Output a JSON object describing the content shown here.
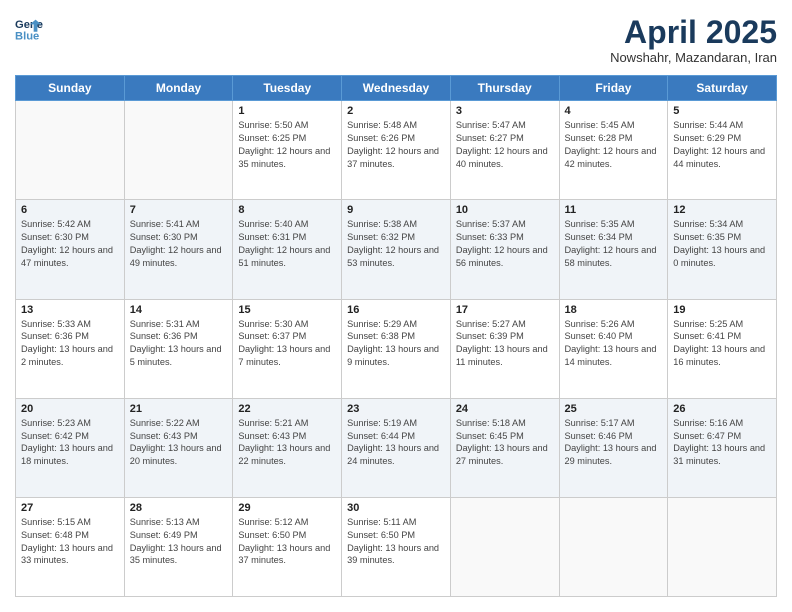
{
  "header": {
    "logo_line1": "General",
    "logo_line2": "Blue",
    "month": "April 2025",
    "location": "Nowshahr, Mazandaran, Iran"
  },
  "days_of_week": [
    "Sunday",
    "Monday",
    "Tuesday",
    "Wednesday",
    "Thursday",
    "Friday",
    "Saturday"
  ],
  "weeks": [
    [
      {
        "day": "",
        "info": ""
      },
      {
        "day": "",
        "info": ""
      },
      {
        "day": "1",
        "info": "Sunrise: 5:50 AM\nSunset: 6:25 PM\nDaylight: 12 hours and 35 minutes."
      },
      {
        "day": "2",
        "info": "Sunrise: 5:48 AM\nSunset: 6:26 PM\nDaylight: 12 hours and 37 minutes."
      },
      {
        "day": "3",
        "info": "Sunrise: 5:47 AM\nSunset: 6:27 PM\nDaylight: 12 hours and 40 minutes."
      },
      {
        "day": "4",
        "info": "Sunrise: 5:45 AM\nSunset: 6:28 PM\nDaylight: 12 hours and 42 minutes."
      },
      {
        "day": "5",
        "info": "Sunrise: 5:44 AM\nSunset: 6:29 PM\nDaylight: 12 hours and 44 minutes."
      }
    ],
    [
      {
        "day": "6",
        "info": "Sunrise: 5:42 AM\nSunset: 6:30 PM\nDaylight: 12 hours and 47 minutes."
      },
      {
        "day": "7",
        "info": "Sunrise: 5:41 AM\nSunset: 6:30 PM\nDaylight: 12 hours and 49 minutes."
      },
      {
        "day": "8",
        "info": "Sunrise: 5:40 AM\nSunset: 6:31 PM\nDaylight: 12 hours and 51 minutes."
      },
      {
        "day": "9",
        "info": "Sunrise: 5:38 AM\nSunset: 6:32 PM\nDaylight: 12 hours and 53 minutes."
      },
      {
        "day": "10",
        "info": "Sunrise: 5:37 AM\nSunset: 6:33 PM\nDaylight: 12 hours and 56 minutes."
      },
      {
        "day": "11",
        "info": "Sunrise: 5:35 AM\nSunset: 6:34 PM\nDaylight: 12 hours and 58 minutes."
      },
      {
        "day": "12",
        "info": "Sunrise: 5:34 AM\nSunset: 6:35 PM\nDaylight: 13 hours and 0 minutes."
      }
    ],
    [
      {
        "day": "13",
        "info": "Sunrise: 5:33 AM\nSunset: 6:36 PM\nDaylight: 13 hours and 2 minutes."
      },
      {
        "day": "14",
        "info": "Sunrise: 5:31 AM\nSunset: 6:36 PM\nDaylight: 13 hours and 5 minutes."
      },
      {
        "day": "15",
        "info": "Sunrise: 5:30 AM\nSunset: 6:37 PM\nDaylight: 13 hours and 7 minutes."
      },
      {
        "day": "16",
        "info": "Sunrise: 5:29 AM\nSunset: 6:38 PM\nDaylight: 13 hours and 9 minutes."
      },
      {
        "day": "17",
        "info": "Sunrise: 5:27 AM\nSunset: 6:39 PM\nDaylight: 13 hours and 11 minutes."
      },
      {
        "day": "18",
        "info": "Sunrise: 5:26 AM\nSunset: 6:40 PM\nDaylight: 13 hours and 14 minutes."
      },
      {
        "day": "19",
        "info": "Sunrise: 5:25 AM\nSunset: 6:41 PM\nDaylight: 13 hours and 16 minutes."
      }
    ],
    [
      {
        "day": "20",
        "info": "Sunrise: 5:23 AM\nSunset: 6:42 PM\nDaylight: 13 hours and 18 minutes."
      },
      {
        "day": "21",
        "info": "Sunrise: 5:22 AM\nSunset: 6:43 PM\nDaylight: 13 hours and 20 minutes."
      },
      {
        "day": "22",
        "info": "Sunrise: 5:21 AM\nSunset: 6:43 PM\nDaylight: 13 hours and 22 minutes."
      },
      {
        "day": "23",
        "info": "Sunrise: 5:19 AM\nSunset: 6:44 PM\nDaylight: 13 hours and 24 minutes."
      },
      {
        "day": "24",
        "info": "Sunrise: 5:18 AM\nSunset: 6:45 PM\nDaylight: 13 hours and 27 minutes."
      },
      {
        "day": "25",
        "info": "Sunrise: 5:17 AM\nSunset: 6:46 PM\nDaylight: 13 hours and 29 minutes."
      },
      {
        "day": "26",
        "info": "Sunrise: 5:16 AM\nSunset: 6:47 PM\nDaylight: 13 hours and 31 minutes."
      }
    ],
    [
      {
        "day": "27",
        "info": "Sunrise: 5:15 AM\nSunset: 6:48 PM\nDaylight: 13 hours and 33 minutes."
      },
      {
        "day": "28",
        "info": "Sunrise: 5:13 AM\nSunset: 6:49 PM\nDaylight: 13 hours and 35 minutes."
      },
      {
        "day": "29",
        "info": "Sunrise: 5:12 AM\nSunset: 6:50 PM\nDaylight: 13 hours and 37 minutes."
      },
      {
        "day": "30",
        "info": "Sunrise: 5:11 AM\nSunset: 6:50 PM\nDaylight: 13 hours and 39 minutes."
      },
      {
        "day": "",
        "info": ""
      },
      {
        "day": "",
        "info": ""
      },
      {
        "day": "",
        "info": ""
      }
    ]
  ]
}
